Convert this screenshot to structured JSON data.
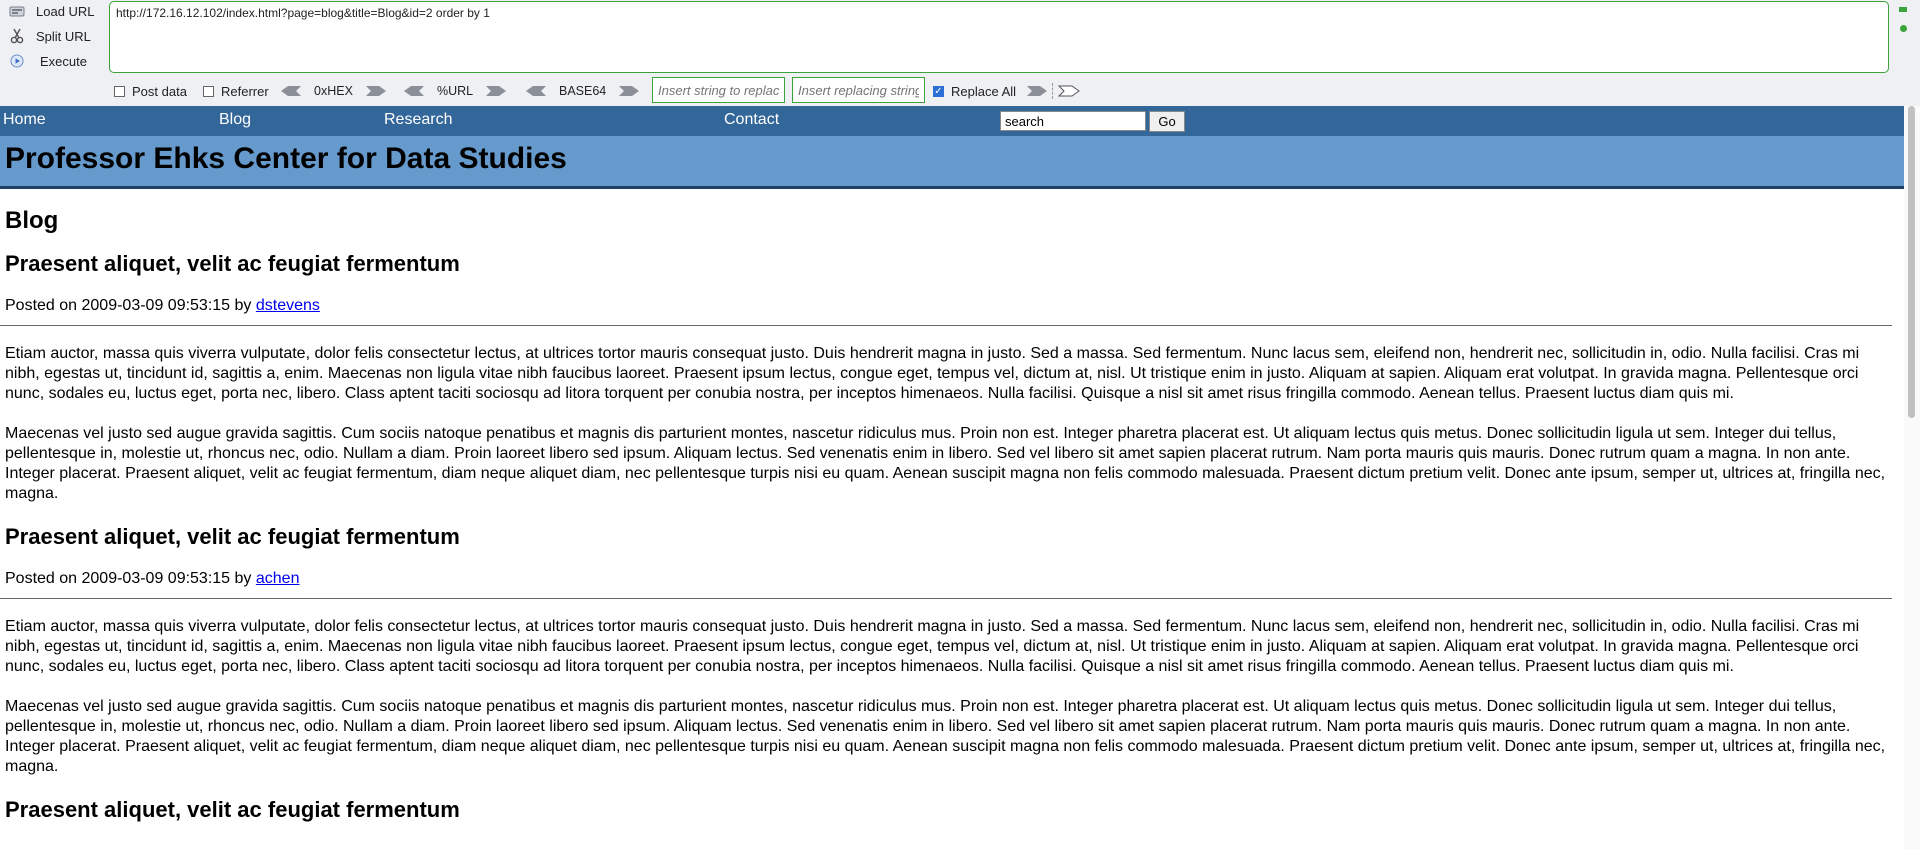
{
  "hackbar": {
    "load_url": "Load URL",
    "split_url": "Split URL",
    "execute": "Execute",
    "url_value": "http://172.16.12.102/index.html?page=blog&title=Blog&id=2 order by 1",
    "post_data": "Post data",
    "referrer": "Referrer",
    "hex": "0xHEX",
    "url_enc": "%URL",
    "base64": "BASE64",
    "replace_placeholder": "Insert string to replace",
    "replacing_placeholder": "Insert replacing string",
    "replace_all": "Replace All",
    "replace_all_checked": true,
    "accent_color": "#3aa43a"
  },
  "nav": {
    "home": "Home",
    "blog": "Blog",
    "research": "Research",
    "contact": "Contact",
    "search_value": "search",
    "go": "Go"
  },
  "site_title": "Professor Ehks Center for Data Studies",
  "section_title": "Blog",
  "posts": [
    {
      "title": "Praesent aliquet, velit ac feugiat fermentum",
      "meta_prefix": "Posted on 2009-03-09 09:53:15 by",
      "author": "dstevens",
      "p1": "Etiam auctor, massa quis viverra vulputate, dolor felis consectetur lectus, at ultrices tortor mauris consequat justo. Duis hendrerit magna in justo. Sed a massa. Sed fermentum. Nunc lacus sem, eleifend non, hendrerit nec, sollicitudin in, odio. Nulla facilisi. Cras mi nibh, egestas ut, tincidunt id, sagittis a, enim. Maecenas non ligula vitae nibh faucibus laoreet. Praesent ipsum lectus, congue eget, tempus vel, dictum at, nisl. Ut tristique enim in justo. Aliquam at sapien. Aliquam erat volutpat. In gravida magna. Pellentesque orci nunc, sodales eu, luctus eget, porta nec, libero. Class aptent taciti sociosqu ad litora torquent per conubia nostra, per inceptos himenaeos. Nulla facilisi. Quisque a nisl sit amet risus fringilla commodo. Aenean tellus. Praesent luctus diam quis mi.",
      "p2": "Maecenas vel justo sed augue gravida sagittis. Cum sociis natoque penatibus et magnis dis parturient montes, nascetur ridiculus mus. Proin non est. Integer pharetra placerat est. Ut aliquam lectus quis metus. Donec sollicitudin ligula ut sem. Integer dui tellus, pellentesque in, molestie ut, rhoncus nec, odio. Nullam a diam. Proin laoreet libero sed ipsum. Aliquam lectus. Sed venenatis enim in libero. Sed vel libero sit amet sapien placerat rutrum. Nam porta mauris quis mauris. Donec rutrum quam a magna. In non ante. Integer placerat. Praesent aliquet, velit ac feugiat fermentum, diam neque aliquet diam, nec pellentesque turpis nisi eu quam. Aenean suscipit magna non felis commodo malesuada. Praesent dictum pretium velit. Donec ante ipsum, semper ut, ultrices at, fringilla nec, magna."
    },
    {
      "title": "Praesent aliquet, velit ac feugiat fermentum",
      "meta_prefix": "Posted on 2009-03-09 09:53:15 by",
      "author": "achen",
      "p1": "Etiam auctor, massa quis viverra vulputate, dolor felis consectetur lectus, at ultrices tortor mauris consequat justo. Duis hendrerit magna in justo. Sed a massa. Sed fermentum. Nunc lacus sem, eleifend non, hendrerit nec, sollicitudin in, odio. Nulla facilisi. Cras mi nibh, egestas ut, tincidunt id, sagittis a, enim. Maecenas non ligula vitae nibh faucibus laoreet. Praesent ipsum lectus, congue eget, tempus vel, dictum at, nisl. Ut tristique enim in justo. Aliquam at sapien. Aliquam erat volutpat. In gravida magna. Pellentesque orci nunc, sodales eu, luctus eget, porta nec, libero. Class aptent taciti sociosqu ad litora torquent per conubia nostra, per inceptos himenaeos. Nulla facilisi. Quisque a nisl sit amet risus fringilla commodo. Aenean tellus. Praesent luctus diam quis mi.",
      "p2": "Maecenas vel justo sed augue gravida sagittis. Cum sociis natoque penatibus et magnis dis parturient montes, nascetur ridiculus mus. Proin non est. Integer pharetra placerat est. Ut aliquam lectus quis metus. Donec sollicitudin ligula ut sem. Integer dui tellus, pellentesque in, molestie ut, rhoncus nec, odio. Nullam a diam. Proin laoreet libero sed ipsum. Aliquam lectus. Sed venenatis enim in libero. Sed vel libero sit amet sapien placerat rutrum. Nam porta mauris quis mauris. Donec rutrum quam a magna. In non ante. Integer placerat. Praesent aliquet, velit ac feugiat fermentum, diam neque aliquet diam, nec pellentesque turpis nisi eu quam. Aenean suscipit magna non felis commodo malesuada. Praesent dictum pretium velit. Donec ante ipsum, semper ut, ultrices at, fringilla nec, magna."
    },
    {
      "title": "Praesent aliquet, velit ac feugiat fermentum"
    }
  ],
  "colors": {
    "nav_bg": "#336699",
    "banner_bg": "#6699cc",
    "link": "#0000ee"
  }
}
